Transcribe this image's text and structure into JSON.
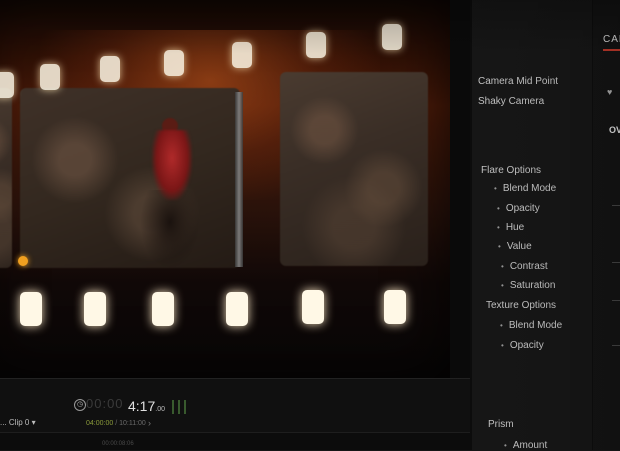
{
  "viewer": {
    "timecode_faded": "00:00",
    "timecode_main": "4:17",
    "timecode_frames": ".00",
    "clip_name": "... Clip 0",
    "clip_dropdown_glyph": "▾",
    "clip_tc_in": "04:00:00",
    "clip_tc_out": "/ 10:11:00",
    "clip_arrow": "›",
    "ruler_mark": "00:00:08:06"
  },
  "inspector": {
    "params": [
      {
        "label": "Camera Mid Point",
        "child": false
      },
      {
        "label": "Shaky Camera",
        "child": false
      },
      {
        "label": "Flare Options",
        "child": false
      },
      {
        "label": "Blend Mode",
        "child": true
      },
      {
        "label": "Opacity",
        "child": true
      },
      {
        "label": "Hue",
        "child": true
      },
      {
        "label": "Value",
        "child": true
      },
      {
        "label": "Contrast",
        "child": true
      },
      {
        "label": "Saturation",
        "child": true
      },
      {
        "label": "Texture Options",
        "child": false
      },
      {
        "label": "Blend Mode",
        "child": true
      },
      {
        "label": "Opacity",
        "child": true
      },
      {
        "label": "Prism",
        "child": false
      },
      {
        "label": "Amount",
        "child": true
      }
    ]
  },
  "right_strip": {
    "tab_label": "CAM",
    "section_label": "OV",
    "heart_glyph": "♥"
  },
  "colors": {
    "accent_red": "#c0392b",
    "timecode_green": "#8a9a3a",
    "sprocket_glow": "#fff8e6"
  }
}
